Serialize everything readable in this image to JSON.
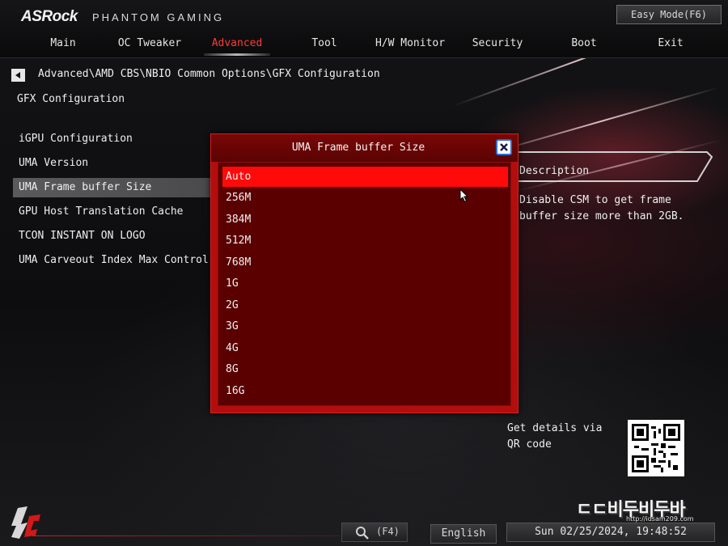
{
  "header": {
    "brand": "ASRock",
    "brand_sub": "PHANTOM GAMING",
    "easy_mode_label": "Easy Mode(F6)"
  },
  "tabs": [
    {
      "label": "Main",
      "active": false
    },
    {
      "label": "OC Tweaker",
      "active": false
    },
    {
      "label": "Advanced",
      "active": true
    },
    {
      "label": "Tool",
      "active": false
    },
    {
      "label": "H/W Monitor",
      "active": false
    },
    {
      "label": "Security",
      "active": false
    },
    {
      "label": "Boot",
      "active": false
    },
    {
      "label": "Exit",
      "active": false
    }
  ],
  "breadcrumb": "Advanced\\AMD CBS\\NBIO Common Options\\GFX Configuration",
  "page_title": "GFX Configuration",
  "menu_items": [
    {
      "label": "iGPU Configuration",
      "selected": false
    },
    {
      "label": "UMA Version",
      "selected": false
    },
    {
      "label": "UMA Frame buffer Size",
      "selected": true
    },
    {
      "label": "GPU Host Translation Cache",
      "selected": false
    },
    {
      "label": "TCON INSTANT ON LOGO",
      "selected": false
    },
    {
      "label": "UMA Carveout Index Max Control",
      "selected": false
    }
  ],
  "description": {
    "title": "Description",
    "text": "Disable CSM to get frame buffer size more than 2GB."
  },
  "dialog": {
    "title": "UMA Frame buffer Size",
    "options": [
      "Auto",
      "256M",
      "384M",
      "512M",
      "768M",
      "1G",
      "2G",
      "3G",
      "4G",
      "8G",
      "16G"
    ],
    "selected_index": 0
  },
  "qr": {
    "text": "Get details via QR code"
  },
  "footer": {
    "search_key": "(F4)",
    "language": "English",
    "datetime": "Sun 02/25/2024, 19:48:52"
  },
  "watermark": {
    "brand": "ㄷㄷ비두비두바",
    "url": "http://idsam209.com"
  },
  "colors": {
    "accent_red": "#ff0a0a",
    "active_tab": "#ff3a3a",
    "dialog_bg": "#5a0000"
  }
}
